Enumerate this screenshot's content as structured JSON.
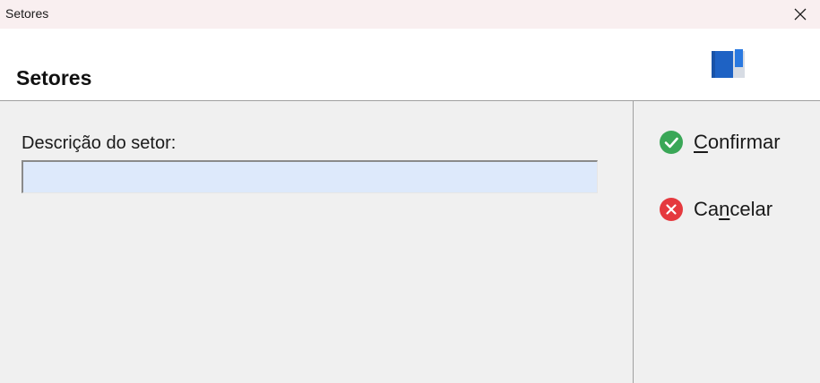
{
  "window": {
    "title": "Setores"
  },
  "header": {
    "heading": "Setores",
    "logo_icon": "book-icon"
  },
  "form": {
    "label": "Descrição do setor:",
    "field_value": "",
    "field_color": "#dde9fb"
  },
  "actions": {
    "confirm": {
      "pre": "",
      "underline": "C",
      "post": "onfirmar",
      "icon": "check-circle-icon",
      "color": "#3aa757"
    },
    "cancel": {
      "pre": "Ca",
      "underline": "n",
      "post": "celar",
      "icon": "x-circle-icon",
      "color": "#e5393e"
    }
  }
}
